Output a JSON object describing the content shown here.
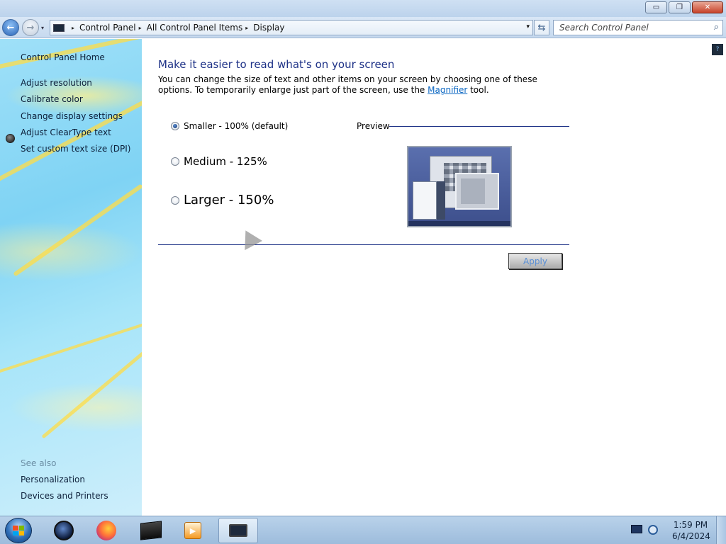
{
  "window": {
    "minimize_glyph": "▭",
    "restore_glyph": "❐",
    "close_glyph": "✕"
  },
  "address_bar": {
    "breadcrumbs": [
      "Control Panel",
      "All Control Panel Items",
      "Display"
    ],
    "separator_glyph": "▸",
    "dropdown_glyph": "▾",
    "refresh_glyph": "⇆"
  },
  "nav": {
    "back_glyph": "←",
    "forward_glyph": "→",
    "recent_glyph": "▾"
  },
  "search": {
    "placeholder": "Search Control Panel",
    "icon": "search-icon",
    "icon_glyph": "⌕"
  },
  "sidebar": {
    "home": "Control Panel Home",
    "items": [
      {
        "label": "Adjust resolution"
      },
      {
        "label": "Calibrate color"
      },
      {
        "label": "Change display settings"
      },
      {
        "label": "Adjust ClearType text"
      },
      {
        "label": "Set custom text size (DPI)"
      }
    ],
    "see_also_title": "See also",
    "see_also": [
      {
        "label": "Personalization"
      },
      {
        "label": "Devices and Printers"
      }
    ]
  },
  "main": {
    "help_glyph": "?",
    "title": "Make it easier to read what's on your screen",
    "description_part1": "You can change the size of text and other items on your screen by choosing one of these options. To temporarily enlarge just part of the screen, use the ",
    "magnifier_link": "Magnifier",
    "description_part2": " tool.",
    "options": [
      {
        "label": "Smaller - 100% (default)",
        "selected": true
      },
      {
        "label": "Medium - 125%",
        "selected": false
      },
      {
        "label": "Larger - 150%",
        "selected": false
      }
    ],
    "preview_label": "Preview",
    "apply_label": "Apply",
    "apply_enabled": false
  },
  "taskbar": {
    "apps": [
      {
        "name": "media-app"
      },
      {
        "name": "firefox"
      },
      {
        "name": "terminal"
      },
      {
        "name": "vlc"
      },
      {
        "name": "display-control-panel",
        "active": true
      }
    ],
    "vlc_glyph": "▶",
    "time": "1:59 PM",
    "date": "6/4/2024"
  },
  "colors": {
    "heading": "#1e3287",
    "link": "#0a66c2",
    "apply_text_disabled": "#5a8fd4"
  }
}
